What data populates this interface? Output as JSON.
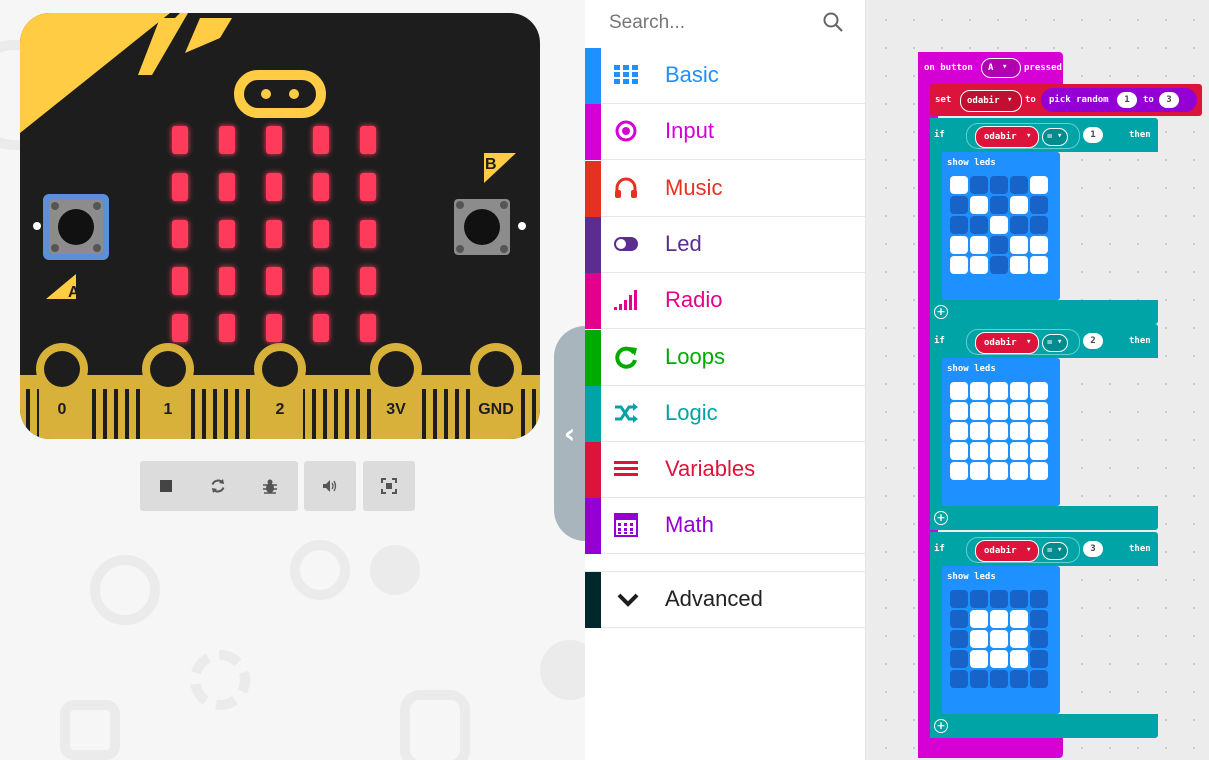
{
  "board": {
    "pins": [
      "0",
      "1",
      "2",
      "3V",
      "GND"
    ],
    "button_a_label": "A",
    "button_b_label": "B",
    "leds": [
      [
        1,
        1,
        1,
        1,
        1
      ],
      [
        1,
        1,
        1,
        1,
        1
      ],
      [
        1,
        1,
        1,
        1,
        1
      ],
      [
        1,
        1,
        1,
        1,
        1
      ],
      [
        1,
        1,
        1,
        1,
        1
      ]
    ],
    "colors": {
      "body": "#1d1d1d",
      "accent": "#ffcc44",
      "pin": "#d8b13a",
      "led": "#ff3b5c",
      "button_a_highlight": "#5b8fd6"
    }
  },
  "sim_controls": [
    {
      "name": "stop-icon"
    },
    {
      "name": "restart-icon"
    },
    {
      "name": "debug-icon"
    },
    {
      "name": "mute-icon"
    },
    {
      "name": "fullscreen-icon"
    }
  ],
  "search": {
    "placeholder": "Search..."
  },
  "categories": [
    {
      "label": "Basic",
      "icon": "grid-icon",
      "color": "#1e90ff"
    },
    {
      "label": "Input",
      "icon": "target-icon",
      "color": "#d400d4"
    },
    {
      "label": "Music",
      "icon": "headphones-icon",
      "color": "#e63022"
    },
    {
      "label": "Led",
      "icon": "toggle-icon",
      "color": "#5c2d91"
    },
    {
      "label": "Radio",
      "icon": "signal-icon",
      "color": "#e3008c"
    },
    {
      "label": "Loops",
      "icon": "loop-icon",
      "color": "#00aa00"
    },
    {
      "label": "Logic",
      "icon": "shuffle-icon",
      "color": "#00a4a6"
    },
    {
      "label": "Variables",
      "icon": "lines-icon",
      "color": "#dc143c"
    },
    {
      "label": "Math",
      "icon": "calculator-icon",
      "color": "#9400d3"
    }
  ],
  "advanced": {
    "label": "Advanced",
    "color": "#00272b"
  },
  "code": {
    "event": {
      "prefix": "on button",
      "button": "A",
      "suffix": "pressed"
    },
    "set": {
      "keyword": "set",
      "variable": "odabir",
      "to": "to",
      "random_label": "pick random",
      "from": "1",
      "to_label": "to",
      "to_value": "3"
    },
    "ifs": [
      {
        "if": "if",
        "variable": "odabir",
        "op": "=",
        "value": "1",
        "then": "then",
        "show": "show leds",
        "leds": [
          [
            1,
            0,
            0,
            0,
            1
          ],
          [
            0,
            1,
            0,
            1,
            0
          ],
          [
            0,
            0,
            1,
            0,
            0
          ],
          [
            1,
            1,
            0,
            1,
            1
          ],
          [
            1,
            1,
            0,
            1,
            1
          ]
        ]
      },
      {
        "if": "if",
        "variable": "odabir",
        "op": "=",
        "value": "2",
        "then": "then",
        "show": "show leds",
        "leds": [
          [
            1,
            1,
            1,
            1,
            1
          ],
          [
            1,
            1,
            1,
            1,
            1
          ],
          [
            1,
            1,
            1,
            1,
            1
          ],
          [
            1,
            1,
            1,
            1,
            1
          ],
          [
            1,
            1,
            1,
            1,
            1
          ]
        ]
      },
      {
        "if": "if",
        "variable": "odabir",
        "op": "=",
        "value": "3",
        "then": "then",
        "show": "show leds",
        "leds": [
          [
            0,
            0,
            0,
            0,
            0
          ],
          [
            0,
            1,
            1,
            1,
            0
          ],
          [
            0,
            1,
            1,
            1,
            0
          ],
          [
            0,
            1,
            1,
            1,
            0
          ],
          [
            0,
            0,
            0,
            0,
            0
          ]
        ]
      }
    ],
    "colors": {
      "event": "#d400d4",
      "variables": "#dc143c",
      "logic": "#00a4a6",
      "basic": "#1e90ff",
      "led_on": "#ffffff",
      "led_off": "#1863c7"
    }
  }
}
